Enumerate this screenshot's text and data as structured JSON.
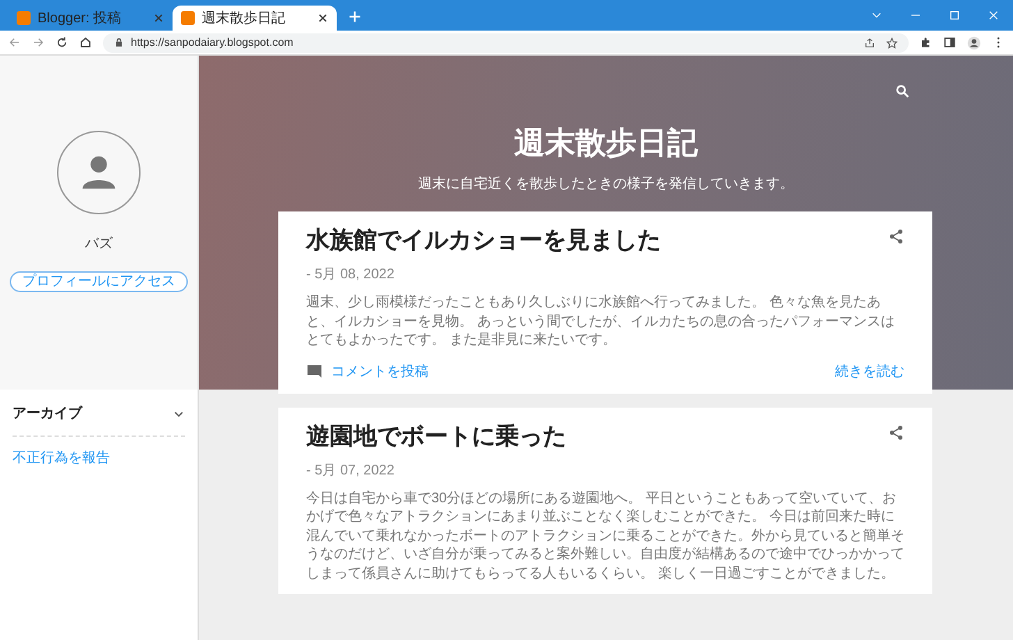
{
  "browser": {
    "tabs": [
      {
        "title": "Blogger: 投稿",
        "selected": false
      },
      {
        "title": "週末散歩日記",
        "selected": true
      }
    ],
    "url": "https://sanpodaiary.blogspot.com"
  },
  "sidebar": {
    "profile_name": "バズ",
    "profile_button": "プロフィールにアクセス",
    "archive": {
      "label": "アーカイブ",
      "expanded": false
    },
    "report_link": "不正行為を報告"
  },
  "hero": {
    "title": "週末散歩日記",
    "description": "週末に自宅近くを散歩したときの様子を発信していきます。"
  },
  "posts": [
    {
      "title": "水族館でイルカショーを見ました",
      "date": "- 5月 08, 2022",
      "body": "週末、少し雨模様だったこともあり久しぶりに水族館へ行ってみました。 色々な魚を見たあと、イルカショーを見物。 あっという間でしたが、イルカたちの息の合ったパフォーマンスはとてもよかったです。 また是非見に来たいです。",
      "comment_link": "コメントを投稿",
      "read_more": "続きを読む"
    },
    {
      "title": "遊園地でボートに乗った",
      "date": "- 5月 07, 2022",
      "body": "今日は自宅から車で30分ほどの場所にある遊園地へ。 平日ということもあって空いていて、おかげで色々なアトラクションにあまり並ぶことなく楽しむことができた。 今日は前回来た時に混んでいて乗れなかったボートのアトラクションに乗ることができた。外から見ていると簡単そうなのだけど、いざ自分が乗ってみると案外難しい。自由度が結構あるので途中でひっかかってしまって係員さんに助けてもらってる人もいるくらい。 楽しく一日過ごすことができました。"
    }
  ]
}
